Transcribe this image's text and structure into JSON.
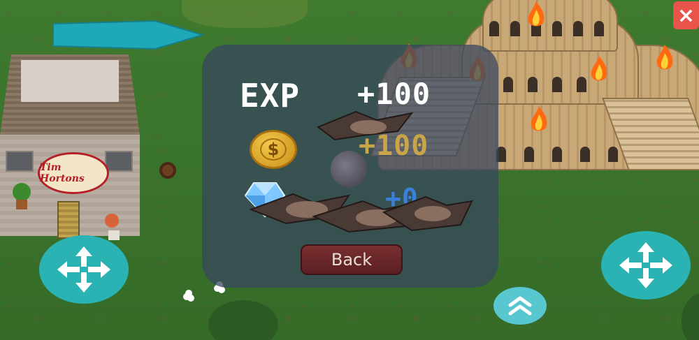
{
  "hud": {
    "close_glyph": "×",
    "nav_arrow_color": "#1fa9b8"
  },
  "sign": {
    "brand_text": "Tim Hortons"
  },
  "rewards_panel": {
    "exp_label": "EXP",
    "exp_value": "+100",
    "coins_value": "+100",
    "gems_value": "+0",
    "back_label": "Back",
    "exp_color": "#ffffff",
    "coins_color": "#c9a54a",
    "gems_color": "#3b7fd6"
  },
  "controls": {
    "left_dpad": "move-arrows-icon",
    "right_dpad": "move-arrows-icon",
    "scroll_up": "double-chevron-up-icon",
    "accent_color": "#2bb3b3"
  }
}
